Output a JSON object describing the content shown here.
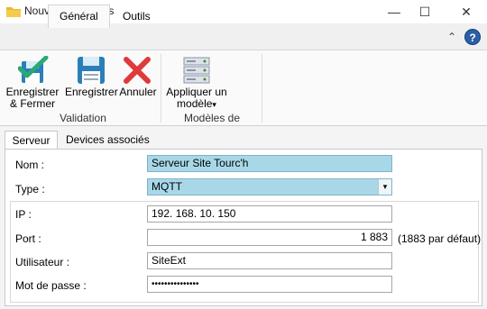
{
  "window": {
    "title": "Nouveau Serveurs",
    "minimize_glyph": "—",
    "maximize_glyph": "☐",
    "close_glyph": "✕"
  },
  "ribbon": {
    "tabs": [
      {
        "label": "Général"
      },
      {
        "label": "Outils"
      }
    ],
    "collapse_glyph": "⌃",
    "help_glyph": "?",
    "buttons": {
      "save_close": {
        "label_line1": "Enregistrer",
        "label_line2": "& Fermer",
        "icon": "save-check-icon"
      },
      "save": {
        "label": "Enregistrer",
        "icon": "floppy-disk-icon"
      },
      "cancel": {
        "label": "Annuler",
        "icon": "red-x-icon"
      },
      "apply_model": {
        "label_line1": "Appliquer un",
        "label_line2": "modèle",
        "dropdown_glyph": "▾",
        "icon": "server-rack-icon"
      }
    },
    "groups": [
      {
        "label": "Validation"
      },
      {
        "label": "Modèles de serveurs"
      }
    ]
  },
  "content_tabs": [
    {
      "label": "Serveur"
    },
    {
      "label": "Devices associés"
    }
  ],
  "form": {
    "nom": {
      "label": "Nom :",
      "value": "Serveur Site Tourc'h"
    },
    "type": {
      "label": "Type :",
      "value": "MQTT",
      "dropdown_glyph": "▾"
    },
    "ip": {
      "label": "IP :",
      "value": "192. 168. 10. 150"
    },
    "port": {
      "label": "Port :",
      "value": "1 883",
      "hint": "(1883 par défaut)"
    },
    "utilisateur": {
      "label": "Utilisateur :",
      "value": "SiteExt"
    },
    "mot_de_passe": {
      "label": "Mot de passe :",
      "value": "•••••••••••••••"
    }
  },
  "colors": {
    "highlight_field": "#a8d8e8",
    "accent_blue": "#2b5fa6",
    "cancel_red": "#e03a3a",
    "check_green": "#2aa876"
  }
}
